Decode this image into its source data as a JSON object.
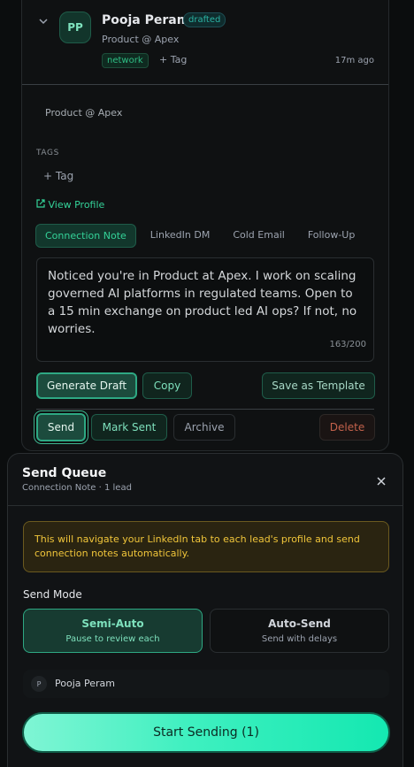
{
  "lead": {
    "initials": "PP",
    "name": "Pooja Peram",
    "status": "drafted",
    "subtitle": "Product @ Apex",
    "tag": "network",
    "add_tag": "Tag",
    "time": "17m ago",
    "company": "Product @ Apex",
    "tags_label": "TAGS",
    "view_profile": "View Profile"
  },
  "tabs": [
    {
      "label": "Connection Note",
      "active": true
    },
    {
      "label": "LinkedIn DM",
      "active": false
    },
    {
      "label": "Cold Email",
      "active": false
    },
    {
      "label": "Follow-Up",
      "active": false
    }
  ],
  "message": {
    "text": "Noticed you're in Product at Apex. I work on scaling governed AI platforms in regulated teams. Open to a 15 min exchange on product led AI ops? If not, no worries.",
    "counter": "163/200"
  },
  "actions": {
    "generate": "Generate Draft",
    "copy": "Copy",
    "save_template": "Save as Template",
    "send": "Send",
    "mark_sent": "Mark Sent",
    "archive": "Archive",
    "delete": "Delete"
  },
  "queue": {
    "title": "Send Queue",
    "subtitle": "Connection Note · 1 lead",
    "warning": "This will navigate your LinkedIn tab to each lead's profile and send connection notes automatically.",
    "mode_label": "Send Mode",
    "modes": [
      {
        "title": "Semi-Auto",
        "desc": "Pause to review each",
        "selected": true
      },
      {
        "title": "Auto-Send",
        "desc": "Send with delays",
        "selected": false
      }
    ],
    "lead_initial": "P",
    "lead_name": "Pooja Peram",
    "start": "Start Sending (1)"
  }
}
